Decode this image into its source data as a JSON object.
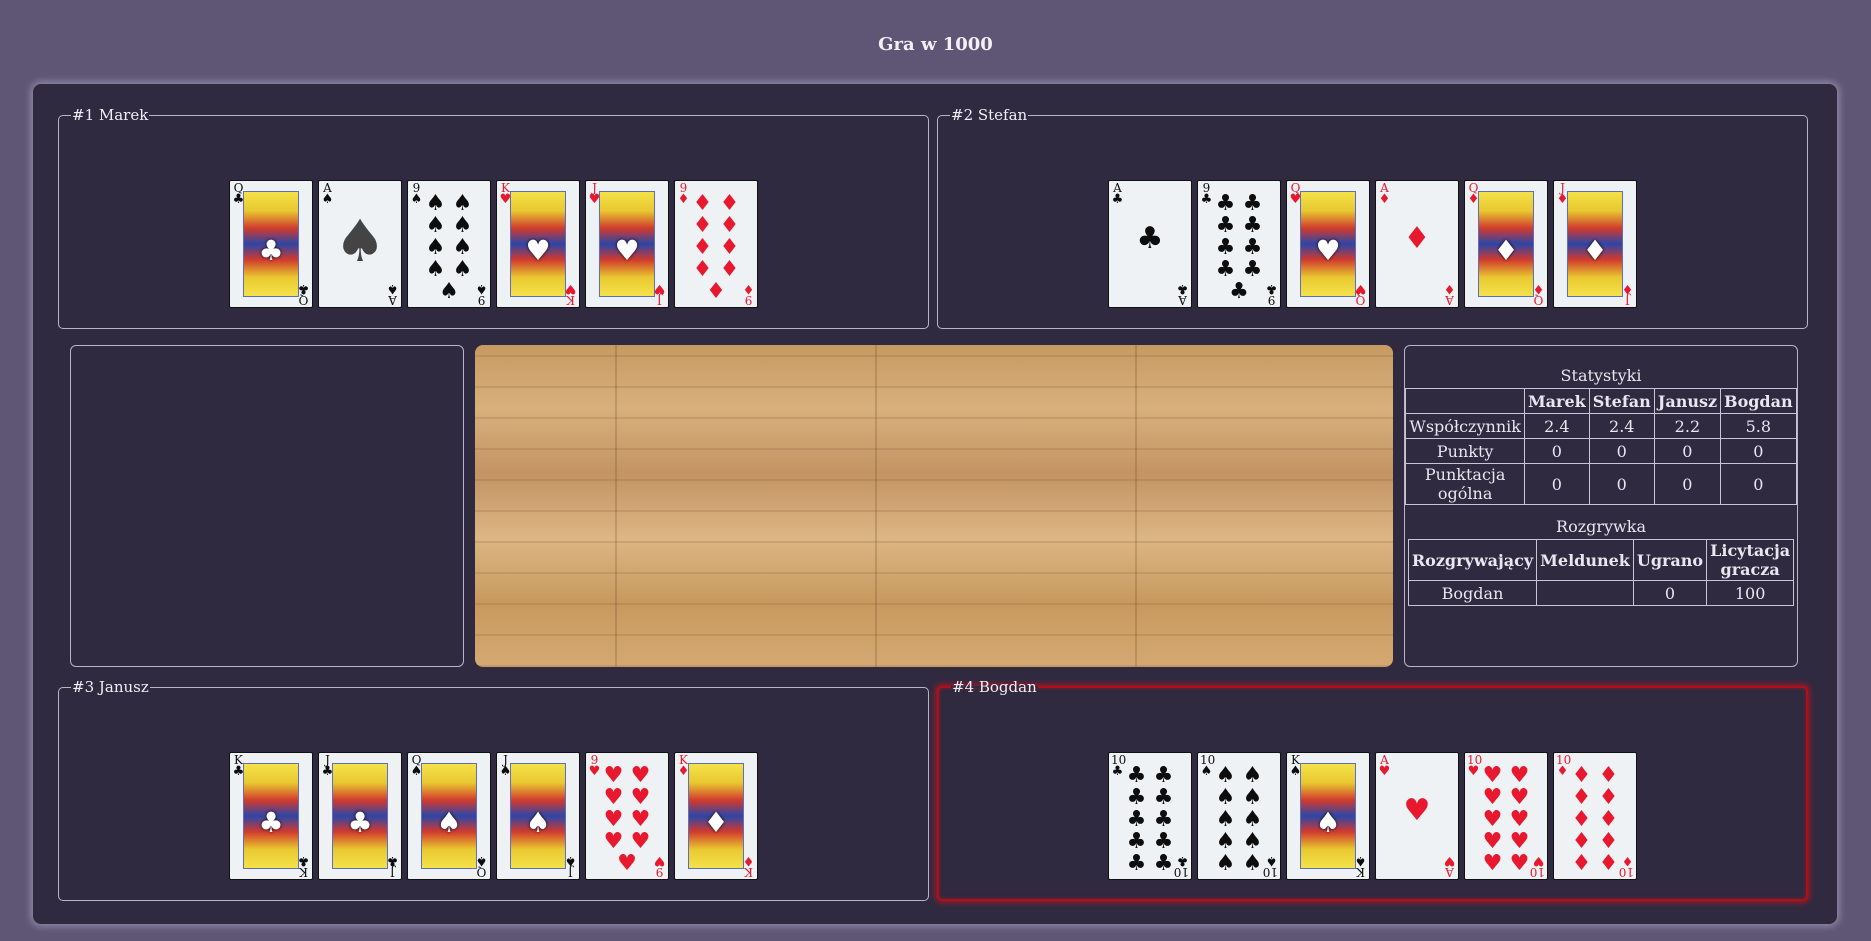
{
  "title": "Gra w 1000",
  "players": [
    {
      "legend": "#1 Marek",
      "active": false,
      "cards": [
        {
          "rank": "Q",
          "suit": "♣",
          "color": "black"
        },
        {
          "rank": "A",
          "suit": "♠",
          "color": "black"
        },
        {
          "rank": "9",
          "suit": "♠",
          "color": "black"
        },
        {
          "rank": "K",
          "suit": "♥",
          "color": "red"
        },
        {
          "rank": "J",
          "suit": "♥",
          "color": "red"
        },
        {
          "rank": "9",
          "suit": "♦",
          "color": "red"
        }
      ]
    },
    {
      "legend": "#2 Stefan",
      "active": false,
      "cards": [
        {
          "rank": "A",
          "suit": "♣",
          "color": "black"
        },
        {
          "rank": "9",
          "suit": "♣",
          "color": "black"
        },
        {
          "rank": "Q",
          "suit": "♥",
          "color": "red"
        },
        {
          "rank": "A",
          "suit": "♦",
          "color": "red"
        },
        {
          "rank": "Q",
          "suit": "♦",
          "color": "red"
        },
        {
          "rank": "J",
          "suit": "♦",
          "color": "red"
        }
      ]
    },
    {
      "legend": "#3 Janusz",
      "active": false,
      "cards": [
        {
          "rank": "K",
          "suit": "♣",
          "color": "black"
        },
        {
          "rank": "J",
          "suit": "♣",
          "color": "black"
        },
        {
          "rank": "Q",
          "suit": "♠",
          "color": "black"
        },
        {
          "rank": "J",
          "suit": "♠",
          "color": "black"
        },
        {
          "rank": "9",
          "suit": "♥",
          "color": "red"
        },
        {
          "rank": "K",
          "suit": "♦",
          "color": "red"
        }
      ]
    },
    {
      "legend": "#4 Bogdan",
      "active": true,
      "cards": [
        {
          "rank": "10",
          "suit": "♣",
          "color": "black"
        },
        {
          "rank": "10",
          "suit": "♠",
          "color": "black"
        },
        {
          "rank": "K",
          "suit": "♠",
          "color": "black"
        },
        {
          "rank": "A",
          "suit": "♥",
          "color": "red"
        },
        {
          "rank": "10",
          "suit": "♥",
          "color": "red"
        },
        {
          "rank": "10",
          "suit": "♦",
          "color": "red"
        }
      ]
    }
  ],
  "stats": {
    "caption": "Statystyki",
    "headers": [
      "",
      "Marek",
      "Stefan",
      "Janusz",
      "Bogdan"
    ],
    "rows": [
      [
        "Współczynnik",
        "2.4",
        "2.4",
        "2.2",
        "5.8"
      ],
      [
        "Punkty",
        "0",
        "0",
        "0",
        "0"
      ],
      [
        "Punktacja ogólna",
        "0",
        "0",
        "0",
        "0"
      ]
    ]
  },
  "round": {
    "caption": "Rozgrywka",
    "headers": [
      "Rozgrywający",
      "Meldunek",
      "Ugrano",
      "Licytacja gracza"
    ],
    "row": [
      "Bogdan",
      "",
      "0",
      "100"
    ]
  },
  "colors": {
    "background": "#5f5575",
    "board": "#2f2a40",
    "active_border": "#b10f18"
  }
}
